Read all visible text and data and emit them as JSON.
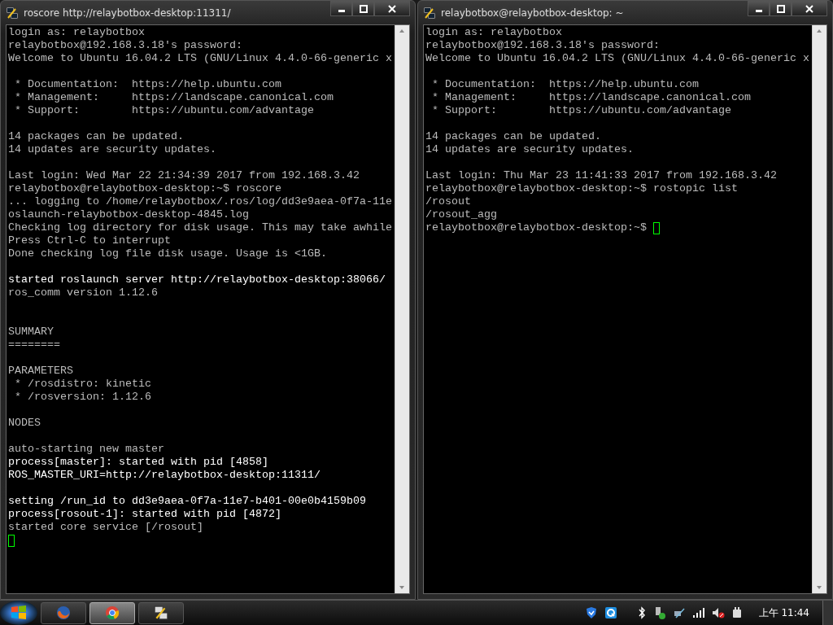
{
  "windows": [
    {
      "title": "roscore http://relaybotbox-desktop:11311/",
      "lines": [
        {
          "kind": "normal",
          "text": "login as: relaybotbox"
        },
        {
          "kind": "normal",
          "text": "relaybotbox@192.168.3.18's password:"
        },
        {
          "kind": "normal",
          "text": "Welcome to Ubuntu 16.04.2 LTS (GNU/Linux 4.4.0-66-generic x"
        },
        {
          "kind": "blank"
        },
        {
          "kind": "normal",
          "text": " * Documentation:  https://help.ubuntu.com"
        },
        {
          "kind": "normal",
          "text": " * Management:     https://landscape.canonical.com"
        },
        {
          "kind": "normal",
          "text": " * Support:        https://ubuntu.com/advantage"
        },
        {
          "kind": "blank"
        },
        {
          "kind": "normal",
          "text": "14 packages can be updated."
        },
        {
          "kind": "normal",
          "text": "14 updates are security updates."
        },
        {
          "kind": "blank"
        },
        {
          "kind": "normal",
          "text": "Last login: Wed Mar 22 21:34:39 2017 from 192.168.3.42"
        },
        {
          "kind": "normal",
          "text": "relaybotbox@relaybotbox-desktop:~$ roscore"
        },
        {
          "kind": "normal",
          "text": "... logging to /home/relaybotbox/.ros/log/dd3e9aea-0f7a-11e"
        },
        {
          "kind": "normal",
          "text": "oslaunch-relaybotbox-desktop-4845.log"
        },
        {
          "kind": "normal",
          "text": "Checking log directory for disk usage. This may take awhile"
        },
        {
          "kind": "normal",
          "text": "Press Ctrl-C to interrupt"
        },
        {
          "kind": "normal",
          "text": "Done checking log file disk usage. Usage is <1GB."
        },
        {
          "kind": "blank"
        },
        {
          "kind": "bright",
          "text": "started roslaunch server http://relaybotbox-desktop:38066/"
        },
        {
          "kind": "normal",
          "text": "ros_comm version 1.12.6"
        },
        {
          "kind": "blank"
        },
        {
          "kind": "blank"
        },
        {
          "kind": "normal",
          "text": "SUMMARY"
        },
        {
          "kind": "normal",
          "text": "========"
        },
        {
          "kind": "blank"
        },
        {
          "kind": "normal",
          "text": "PARAMETERS"
        },
        {
          "kind": "normal",
          "text": " * /rosdistro: kinetic"
        },
        {
          "kind": "normal",
          "text": " * /rosversion: 1.12.6"
        },
        {
          "kind": "blank"
        },
        {
          "kind": "normal",
          "text": "NODES"
        },
        {
          "kind": "blank"
        },
        {
          "kind": "normal",
          "text": "auto-starting new master"
        },
        {
          "kind": "bright",
          "text": "process[master]: started with pid [4858]"
        },
        {
          "kind": "bright",
          "text": "ROS_MASTER_URI=http://relaybotbox-desktop:11311/"
        },
        {
          "kind": "blank"
        },
        {
          "kind": "bright",
          "text": "setting /run_id to dd3e9aea-0f7a-11e7-b401-00e0b4159b09"
        },
        {
          "kind": "bright",
          "text": "process[rosout-1]: started with pid [4872]"
        },
        {
          "kind": "normal",
          "text": "started core service [/rosout]"
        },
        {
          "kind": "cursor"
        }
      ]
    },
    {
      "title": "relaybotbox@relaybotbox-desktop: ~",
      "lines": [
        {
          "kind": "normal",
          "text": "login as: relaybotbox"
        },
        {
          "kind": "normal",
          "text": "relaybotbox@192.168.3.18's password:"
        },
        {
          "kind": "normal",
          "text": "Welcome to Ubuntu 16.04.2 LTS (GNU/Linux 4.4.0-66-generic x"
        },
        {
          "kind": "blank"
        },
        {
          "kind": "normal",
          "text": " * Documentation:  https://help.ubuntu.com"
        },
        {
          "kind": "normal",
          "text": " * Management:     https://landscape.canonical.com"
        },
        {
          "kind": "normal",
          "text": " * Support:        https://ubuntu.com/advantage"
        },
        {
          "kind": "blank"
        },
        {
          "kind": "normal",
          "text": "14 packages can be updated."
        },
        {
          "kind": "normal",
          "text": "14 updates are security updates."
        },
        {
          "kind": "blank"
        },
        {
          "kind": "normal",
          "text": "Last login: Thu Mar 23 11:41:33 2017 from 192.168.3.42"
        },
        {
          "kind": "normal",
          "text": "relaybotbox@relaybotbox-desktop:~$ rostopic list"
        },
        {
          "kind": "normal",
          "text": "/rosout"
        },
        {
          "kind": "normal",
          "text": "/rosout_agg"
        },
        {
          "kind": "input",
          "text": "relaybotbox@relaybotbox-desktop:~$ "
        }
      ]
    }
  ],
  "taskbar": {
    "apps": [
      {
        "kind": "firefox",
        "selected": false
      },
      {
        "kind": "chrome",
        "selected": true
      },
      {
        "kind": "putty",
        "selected": false
      }
    ],
    "clock": "上午 11:44"
  }
}
